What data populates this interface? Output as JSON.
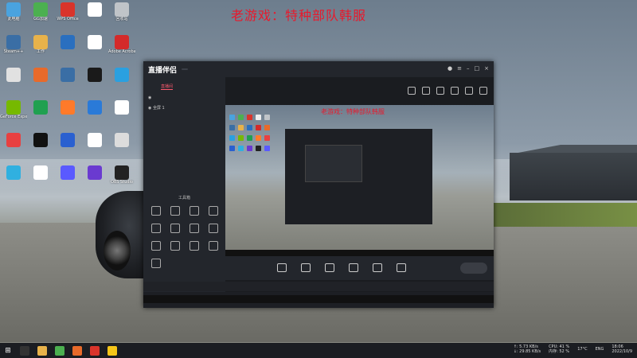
{
  "overlay_title": "老游戏：特种部队韩服",
  "desktop_icons": [
    {
      "label": "此电脑",
      "color": "#4aa3df"
    },
    {
      "label": "GG加速",
      "color": "#4cb050"
    },
    {
      "label": "WPS Office",
      "color": "#d9342b"
    },
    {
      "label": "",
      "color": "#ffffff"
    },
    {
      "label": "回收站",
      "color": "#c0c4c8"
    },
    {
      "label": "Steam++",
      "color": "#3a6ea5"
    },
    {
      "label": "工作",
      "color": "#e8b24a"
    },
    {
      "label": "",
      "color": "#2a6fbf"
    },
    {
      "label": "",
      "color": "#ffffff"
    },
    {
      "label": "Adobe Acrobat DC",
      "color": "#d42a2a"
    },
    {
      "label": "",
      "color": "#e1e1e1"
    },
    {
      "label": "",
      "color": "#e86a2a"
    },
    {
      "label": "",
      "color": "#3a6ea5"
    },
    {
      "label": "",
      "color": "#1a1a1a"
    },
    {
      "label": "",
      "color": "#2aa0e0"
    },
    {
      "label": "GeForce Experience",
      "color": "#76b900"
    },
    {
      "label": "",
      "color": "#20a050"
    },
    {
      "label": "",
      "color": "#ff7a2a"
    },
    {
      "label": "",
      "color": "#2a7ad8"
    },
    {
      "label": "",
      "color": "#ffffff"
    },
    {
      "label": "",
      "color": "#e84040"
    },
    {
      "label": "",
      "color": "#111111"
    },
    {
      "label": "",
      "color": "#2a60d0"
    },
    {
      "label": "",
      "color": "#ffffff"
    },
    {
      "label": "",
      "color": "#dcdcdc"
    },
    {
      "label": "",
      "color": "#30b0e0"
    },
    {
      "label": "",
      "color": "#ffffff"
    },
    {
      "label": "",
      "color": "#5a5aff"
    },
    {
      "label": "",
      "color": "#6a3ad0"
    },
    {
      "label": "OBS Studio",
      "color": "#222222"
    }
  ],
  "app": {
    "logo": "直播伴侣",
    "badge": "",
    "tip": "",
    "left_tabs": [
      "",
      "",
      "直播间"
    ],
    "scenes": [
      "",
      "全屏 1"
    ],
    "tools_title": "工具箱",
    "tools": [
      "",
      "",
      "",
      "",
      "",
      "",
      "",
      "",
      "",
      "",
      "",
      "",
      ""
    ],
    "preview_title": "老游戏：特种部队韩服",
    "controls": [
      "",
      "",
      "",
      "",
      "",
      ""
    ],
    "live_button": "",
    "footer_warning": "",
    "footer_link": "",
    "status_text": ""
  },
  "taskbar": {
    "weather": "17°C",
    "lang": "ENG",
    "time": "18:06",
    "date": "2022/10/9",
    "net_up": "↑: 5.73 KB/s",
    "net_down": "↓: 29.85 KB/s",
    "cpu": "CPU: 41 %",
    "mem": "内存: 52 %"
  }
}
